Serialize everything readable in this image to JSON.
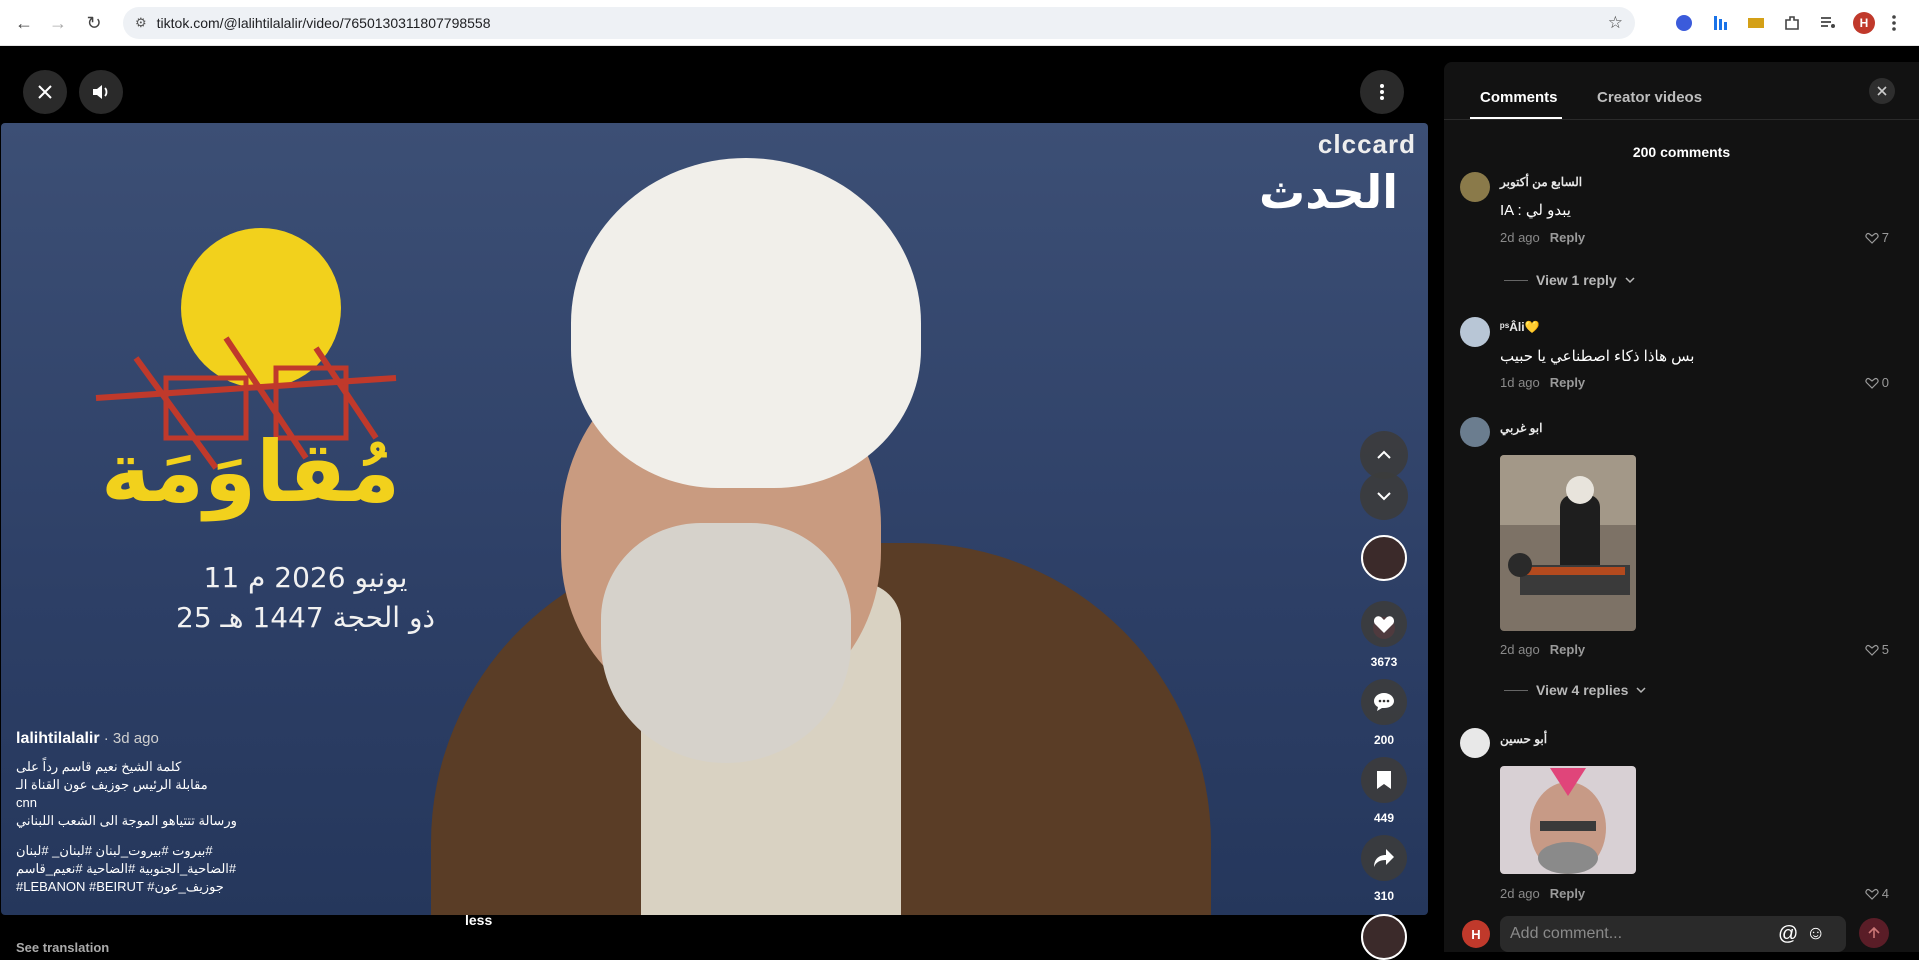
{
  "browser": {
    "url": "tiktok.com/@lalihtilalalir/video/7650130311807798558",
    "profile_initial": "H"
  },
  "poster": {
    "title_ar": "مُقاوَمَة",
    "date_line_1": "11 يونيو 2026 م",
    "date_line_2": "25 ذو الحجة 1447 هـ",
    "channel_brand": "clccard",
    "channel_logo": "الحدث"
  },
  "video": {
    "username": "lalihtilalalir",
    "age": " · 3d ago",
    "caption_lines": [
      "كلمة الشيخ نعيم قاسم رداً على",
      "مقابلة الرئيس جوزيف عون القناة الـ",
      "cnn",
      "ورسالة تتتياهو الموجة الى الشعب اللبناني",
      "#بيروت #بيروت_لبنان #لبنان_ #لبنان",
      "#الضاحية_الجنوبية #الضاحية #نعيم_قاسم",
      "#LEBANON #BEIRUT #جوزيف_عون"
    ],
    "less_label": "less",
    "see_translation": "See translation"
  },
  "actions": {
    "likes": "3673",
    "comments": "200",
    "saves": "449",
    "shares": "310"
  },
  "comments_panel": {
    "tabs": [
      "Comments",
      "Creator videos"
    ],
    "count_title": "200 comments",
    "reply_label": "Reply",
    "input_placeholder": "Add comment...",
    "comments": [
      {
        "user": "السابع من أكتوبر",
        "text": "IA : يبدو لي",
        "age": "2d ago",
        "likes": "7",
        "view_replies": "View 1 reply"
      },
      {
        "user": "ᵖˢÂli💛",
        "text": "بس هاذا ذكاء اصطناعي يا حبيب",
        "age": "1d ago",
        "likes": "0"
      },
      {
        "user": "ابو غربي",
        "age": "2d ago",
        "likes": "5",
        "view_replies": "View 4 replies"
      },
      {
        "user": "أبو حسين",
        "age": "2d ago",
        "likes": "4"
      }
    ]
  },
  "colors": {
    "accent": "#fe2c55",
    "panel_bg": "#121212"
  }
}
